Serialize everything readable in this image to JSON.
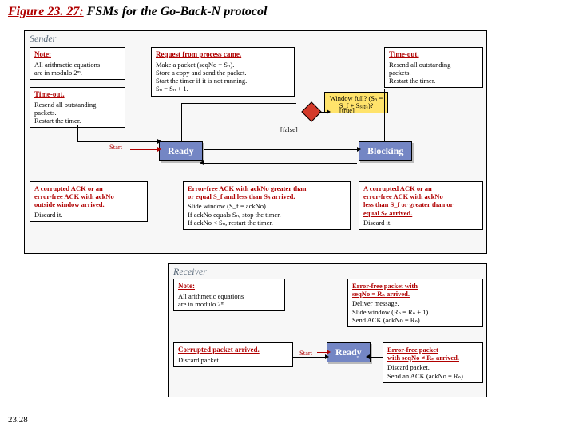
{
  "title": {
    "number": "Figure 23. 27:",
    "text": "FSMs for the Go-Back-N protocol"
  },
  "page_number": "23.28",
  "sender": {
    "label": "Sender",
    "note": {
      "head": "Note:",
      "body": "All arithmetic equations\nare in modulo 2ᵐ."
    },
    "timeout_left": {
      "head": "Time-out.",
      "body": "Resend all outstanding\npackets.\nRestart the timer."
    },
    "timeout_right": {
      "head": "Time-out.",
      "body": "Resend all outstanding\npackets.\nRestart the timer."
    },
    "request": {
      "head": "Request from process came.",
      "body": "Make a packet (seqNo = Sₙ).\nStore a copy and send the packet.\nStart the timer if it is not running.\nSₙ = Sₙ + 1."
    },
    "window_full": "Window full?\n(Sₙ = S_f + Sₛᵢ𝓏ₑ)?",
    "true": "[true]",
    "false": "[false]",
    "start": "Start",
    "ready": "Ready",
    "blocking": "Blocking",
    "corrupt_left": {
      "head": "A corrupted ACK or an\nerror-free ACK with ackNo\noutside window arrived.",
      "body": "Discard it."
    },
    "good_ack": {
      "head": "Error-free ACK with ackNo greater than\nor equal S_f and less than Sₙ arrived.",
      "body": "Slide window (S_f = ackNo).\nIf ackNo equals Sₙ, stop the timer.\nIf ackNo < Sₙ, restart the timer."
    },
    "corrupt_right": {
      "head": "A corrupted ACK or an\nerror-free ACK with ackNo\nless than S_f or greater than or\nequal Sₙ arrived.",
      "body": "Discard it."
    }
  },
  "receiver": {
    "label": "Receiver",
    "note": {
      "head": "Note:",
      "body": "All arithmetic equations\nare in modulo 2ᵐ."
    },
    "good_pkt": {
      "head": "Error-free packet with\nseqNo = Rₙ arrived.",
      "body": "Deliver message.\nSlide window (Rₙ = Rₙ + 1).\nSend ACK (ackNo = Rₙ)."
    },
    "corrupt": {
      "head": "Corrupted packet arrived.",
      "body": "Discard packet."
    },
    "wrong_seq": {
      "head": "Error-free packet\nwith seqNo ≠ Rₙ arrived.",
      "body": "Discard packet.\nSend an ACK (ackNo = Rₙ)."
    },
    "start": "Start",
    "ready": "Ready"
  }
}
